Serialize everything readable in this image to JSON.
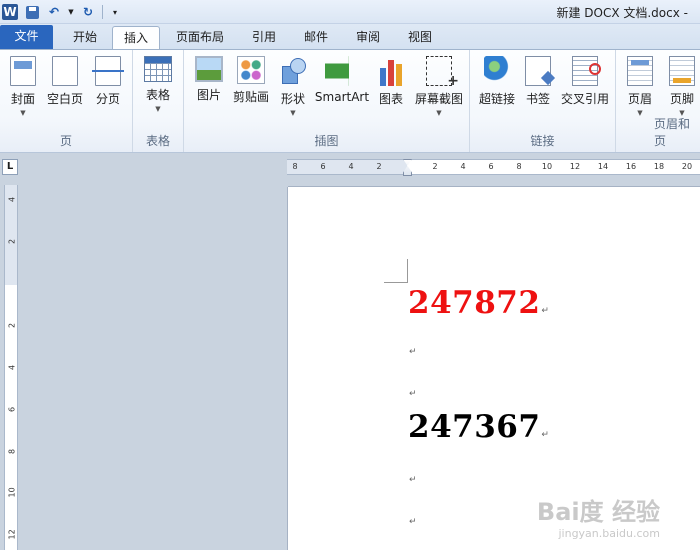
{
  "window": {
    "title": "新建 DOCX 文档.docx -"
  },
  "tabs": [
    {
      "label": "文件"
    },
    {
      "label": "开始"
    },
    {
      "label": "插入"
    },
    {
      "label": "页面布局"
    },
    {
      "label": "引用"
    },
    {
      "label": "邮件"
    },
    {
      "label": "审阅"
    },
    {
      "label": "视图"
    }
  ],
  "ribbon": {
    "pages": {
      "cover": "封面",
      "blank": "空白页",
      "break": "分页",
      "group": "页"
    },
    "tables": {
      "table": "表格",
      "group": "表格"
    },
    "illustrations": {
      "picture": "图片",
      "clipart": "剪贴画",
      "shapes": "形状",
      "smartart": "SmartArt",
      "chart": "图表",
      "screenshot": "屏幕截图",
      "group": "插图"
    },
    "links": {
      "hyperlink": "超链接",
      "bookmark": "书签",
      "xref": "交叉引用",
      "group": "链接"
    },
    "header_footer": {
      "header": "页眉",
      "footer": "页脚",
      "group": "页眉和页"
    }
  },
  "ruler": {
    "h_ticks": [
      "8",
      "6",
      "4",
      "2",
      "2",
      "4",
      "6",
      "8",
      "10",
      "12",
      "14",
      "16",
      "18",
      "20"
    ],
    "v_ticks": [
      "4",
      "2",
      "2",
      "4",
      "6",
      "8",
      "10",
      "12"
    ]
  },
  "document": {
    "line1": "247872",
    "line2": "247367",
    "line1_color": "#ee1111",
    "line2_color": "#000000",
    "para_mark": "↵"
  },
  "watermark": {
    "brand": "Bai度 经验",
    "url": "jingyan.baidu.com"
  }
}
